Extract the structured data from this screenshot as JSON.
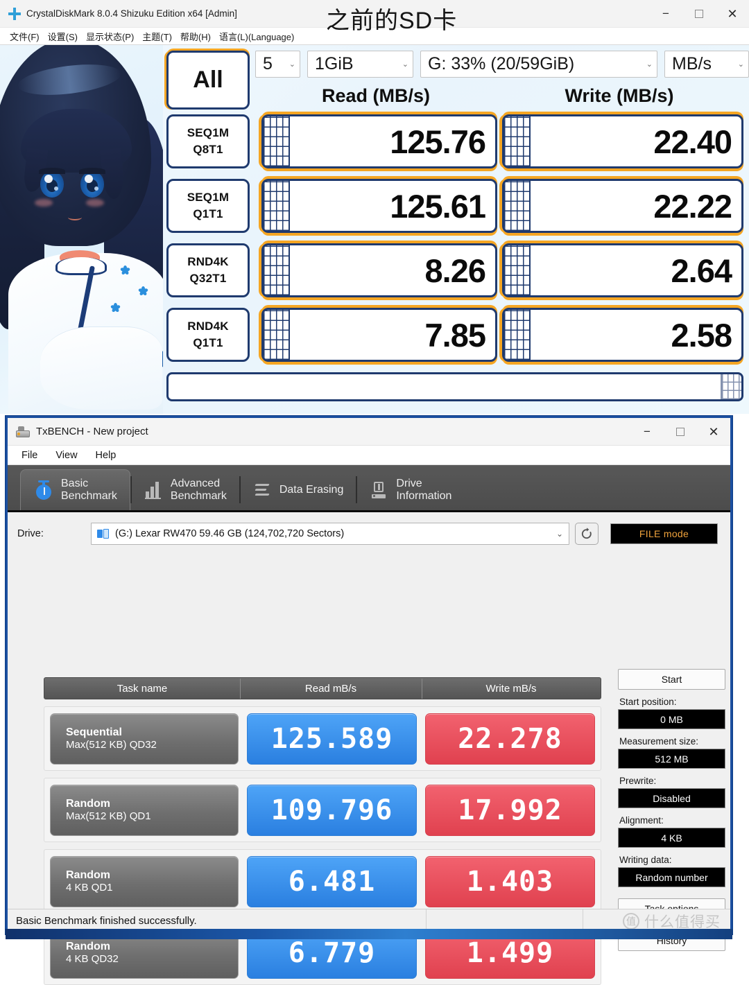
{
  "cdm": {
    "title": "CrystalDiskMark 8.0.4 Shizuku Edition x64 [Admin]",
    "overlay_note": "之前的SD卡",
    "window_controls": {
      "minimize": "−",
      "maximize": "",
      "close": "✕"
    },
    "menu": [
      {
        "label": "文件(F)"
      },
      {
        "label": "设置(S)"
      },
      {
        "label": "显示状态(P)"
      },
      {
        "label": "主题(T)"
      },
      {
        "label": "帮助(H)"
      },
      {
        "label": "语言(L)(Language)"
      }
    ],
    "toolbar": {
      "all_button": "All",
      "count": "5",
      "size": "1GiB",
      "drive": "G: 33% (20/59GiB)",
      "unit": "MB/s",
      "caret": "⌄"
    },
    "columns": {
      "read": "Read (MB/s)",
      "write": "Write (MB/s)"
    },
    "rows": [
      {
        "name1": "SEQ1M",
        "name2": "Q8T1",
        "read": "125.76",
        "write": "22.40"
      },
      {
        "name1": "SEQ1M",
        "name2": "Q1T1",
        "read": "125.61",
        "write": "22.22"
      },
      {
        "name1": "RND4K",
        "name2": "Q32T1",
        "read": "8.26",
        "write": "2.64"
      },
      {
        "name1": "RND4K",
        "name2": "Q1T1",
        "read": "7.85",
        "write": "2.58"
      }
    ],
    "progress_text": ""
  },
  "txbench": {
    "title": "TxBENCH - New project",
    "window_controls": {
      "minimize": "−",
      "maximize": "",
      "close": "✕"
    },
    "menu": [
      {
        "label": "File"
      },
      {
        "label": "View"
      },
      {
        "label": "Help"
      }
    ],
    "tabs": [
      {
        "line1": "Basic",
        "line2": "Benchmark",
        "icon": "stopwatch-icon",
        "active": true
      },
      {
        "line1": "Advanced",
        "line2": "Benchmark",
        "icon": "bar-chart-icon",
        "active": false
      },
      {
        "line1": "Data Erasing",
        "line2": "",
        "icon": "erase-icon",
        "active": false
      },
      {
        "line1": "Drive",
        "line2": "Information",
        "icon": "drive-icon",
        "active": false
      }
    ],
    "drive": {
      "label": "Drive:",
      "value": "(G:) Lexar RW470  59.46 GB (124,702,720 Sectors)",
      "caret": "⌄",
      "refresh_icon": "refresh-icon",
      "file_mode": "FILE mode"
    },
    "table_headers": {
      "task": "Task name",
      "read": "Read mB/s",
      "write": "Write mB/s"
    },
    "results": [
      {
        "task1": "Sequential",
        "task2": "Max(512 KB) QD32",
        "read": "125.589",
        "write": "22.278"
      },
      {
        "task1": "Random",
        "task2": "Max(512 KB) QD1",
        "read": "109.796",
        "write": "17.992"
      },
      {
        "task1": "Random",
        "task2": "4 KB QD1",
        "read": "6.481",
        "write": "1.403"
      },
      {
        "task1": "Random",
        "task2": "4 KB QD32",
        "read": "6.779",
        "write": "1.499"
      }
    ],
    "panel": {
      "start_button": "Start",
      "start_position_label": "Start position:",
      "start_position_value": "0 MB",
      "measurement_size_label": "Measurement size:",
      "measurement_size_value": "512 MB",
      "prewrite_label": "Prewrite:",
      "prewrite_value": "Disabled",
      "alignment_label": "Alignment:",
      "alignment_value": "4 KB",
      "writing_data_label": "Writing data:",
      "writing_data_value": "Random number",
      "task_options_button": "Task options",
      "history_button": "History"
    },
    "status": "Basic Benchmark finished successfully."
  },
  "watermark": {
    "mark": "值",
    "text": "什么值得买"
  },
  "colors": {
    "cdm_border": "#1f3a6e",
    "cdm_accent": "#f5a623",
    "tx_read": "#2a7fe0",
    "tx_write": "#e0414f",
    "tx_window_border": "#1b4fa0",
    "file_mode_text": "#f0a33c"
  }
}
